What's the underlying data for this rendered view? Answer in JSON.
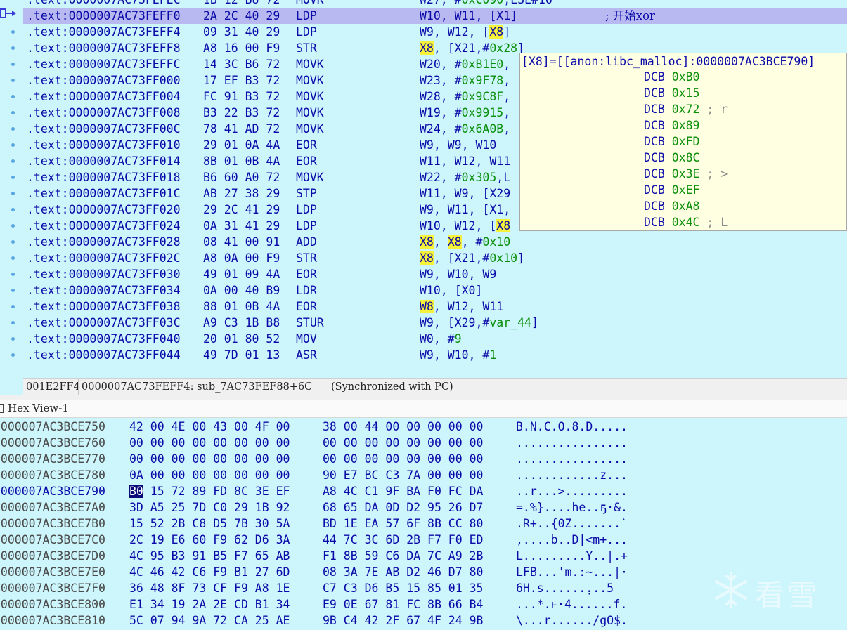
{
  "disassembly": {
    "rows": [
      {
        "addr": ".text:0000007AC73FEFEC",
        "bytes": "1B 12 B8 72",
        "mnem": "MOVK",
        "ops": [
          {
            "t": "W27, #"
          },
          {
            "t": "0xC090",
            "c": "num"
          },
          {
            "t": ",LSL#16"
          }
        ]
      },
      {
        "addr": ".text:0000007AC73FEFF0",
        "bytes": "2A 2C 40 29",
        "mnem": "LDP",
        "ops": [
          {
            "t": "W10, W11, [X1]"
          }
        ],
        "comment": "; 开始xor",
        "selected": true
      },
      {
        "addr": ".text:0000007AC73FEFF4",
        "bytes": "09 31 40 29",
        "mnem": "LDP",
        "ops": [
          {
            "t": "W9, W12, ["
          },
          {
            "t": "X8",
            "c": "hl"
          },
          {
            "t": "]"
          }
        ]
      },
      {
        "addr": ".text:0000007AC73FEFF8",
        "bytes": "A8 16 00 F9",
        "mnem": "STR",
        "ops": [
          {
            "t": "X8",
            "c": "hl"
          },
          {
            "t": ", [X21,#"
          },
          {
            "t": "0x28",
            "c": "num"
          },
          {
            "t": "]"
          }
        ]
      },
      {
        "addr": ".text:0000007AC73FEFFC",
        "bytes": "14 3C B6 72",
        "mnem": "MOVK",
        "ops": [
          {
            "t": "W20, #"
          },
          {
            "t": "0xB1E0",
            "c": "num"
          },
          {
            "t": ","
          }
        ]
      },
      {
        "addr": ".text:0000007AC73FF000",
        "bytes": "17 EF B3 72",
        "mnem": "MOVK",
        "ops": [
          {
            "t": "W23, #"
          },
          {
            "t": "0x9F78",
            "c": "num"
          },
          {
            "t": ","
          }
        ]
      },
      {
        "addr": ".text:0000007AC73FF004",
        "bytes": "FC 91 B3 72",
        "mnem": "MOVK",
        "ops": [
          {
            "t": "W28, #"
          },
          {
            "t": "0x9C8F",
            "c": "num"
          },
          {
            "t": ","
          }
        ]
      },
      {
        "addr": ".text:0000007AC73FF008",
        "bytes": "B3 22 B3 72",
        "mnem": "MOVK",
        "ops": [
          {
            "t": "W19, #"
          },
          {
            "t": "0x9915",
            "c": "num"
          },
          {
            "t": ","
          }
        ]
      },
      {
        "addr": ".text:0000007AC73FF00C",
        "bytes": "78 41 AD 72",
        "mnem": "MOVK",
        "ops": [
          {
            "t": "W24, #"
          },
          {
            "t": "0x6A0B",
            "c": "num"
          },
          {
            "t": ","
          }
        ]
      },
      {
        "addr": ".text:0000007AC73FF010",
        "bytes": "29 01 0A 4A",
        "mnem": "EOR",
        "ops": [
          {
            "t": "W9, W9, W10"
          }
        ]
      },
      {
        "addr": ".text:0000007AC73FF014",
        "bytes": "8B 01 0B 4A",
        "mnem": "EOR",
        "ops": [
          {
            "t": "W11, W12, W11"
          }
        ]
      },
      {
        "addr": ".text:0000007AC73FF018",
        "bytes": "B6 60 A0 72",
        "mnem": "MOVK",
        "ops": [
          {
            "t": "W22, #"
          },
          {
            "t": "0x305",
            "c": "num"
          },
          {
            "t": ",L"
          }
        ]
      },
      {
        "addr": ".text:0000007AC73FF01C",
        "bytes": "AB 27 38 29",
        "mnem": "STP",
        "ops": [
          {
            "t": "W11, W9, [X29"
          }
        ]
      },
      {
        "addr": ".text:0000007AC73FF020",
        "bytes": "29 2C 41 29",
        "mnem": "LDP",
        "ops": [
          {
            "t": "W9, W11, [X1,"
          }
        ]
      },
      {
        "addr": ".text:0000007AC73FF024",
        "bytes": "0A 31 41 29",
        "mnem": "LDP",
        "ops": [
          {
            "t": "W10, W12, ["
          },
          {
            "t": "X8",
            "c": "hl"
          }
        ]
      },
      {
        "addr": ".text:0000007AC73FF028",
        "bytes": "08 41 00 91",
        "mnem": "ADD",
        "ops": [
          {
            "t": "X8",
            "c": "hl"
          },
          {
            "t": ", "
          },
          {
            "t": "X8",
            "c": "hl"
          },
          {
            "t": ", #"
          },
          {
            "t": "0x10",
            "c": "num"
          }
        ]
      },
      {
        "addr": ".text:0000007AC73FF02C",
        "bytes": "A8 0A 00 F9",
        "mnem": "STR",
        "ops": [
          {
            "t": "X8",
            "c": "hl"
          },
          {
            "t": ", [X21,#"
          },
          {
            "t": "0x10",
            "c": "num"
          },
          {
            "t": "]"
          }
        ]
      },
      {
        "addr": ".text:0000007AC73FF030",
        "bytes": "49 01 09 4A",
        "mnem": "EOR",
        "ops": [
          {
            "t": "W9, W10, W9"
          }
        ]
      },
      {
        "addr": ".text:0000007AC73FF034",
        "bytes": "0A 00 40 B9",
        "mnem": "LDR",
        "ops": [
          {
            "t": "W10, [X0]"
          }
        ]
      },
      {
        "addr": ".text:0000007AC73FF038",
        "bytes": "88 01 0B 4A",
        "mnem": "EOR",
        "ops": [
          {
            "t": "W8",
            "c": "hl"
          },
          {
            "t": ", W12, W11"
          }
        ]
      },
      {
        "addr": ".text:0000007AC73FF03C",
        "bytes": "A9 C3 1B B8",
        "mnem": "STUR",
        "ops": [
          {
            "t": "W9, [X29,#"
          },
          {
            "t": "var_44",
            "c": "num"
          },
          {
            "t": "]"
          }
        ]
      },
      {
        "addr": ".text:0000007AC73FF040",
        "bytes": "20 01 80 52",
        "mnem": "MOV",
        "ops": [
          {
            "t": "W0, #"
          },
          {
            "t": "9",
            "c": "num"
          }
        ]
      },
      {
        "addr": ".text:0000007AC73FF044",
        "bytes": "49 7D 01 13",
        "mnem": "ASR",
        "ops": [
          {
            "t": "W9, W10, #"
          },
          {
            "t": "1",
            "c": "num"
          }
        ]
      }
    ]
  },
  "popup": {
    "title": "[X8]=[[anon:libc_malloc]:0000007AC3BCE790]",
    "items": [
      {
        "dir": "DCB",
        "val": "0xB0",
        "cmt": ""
      },
      {
        "dir": "DCB",
        "val": "0x15",
        "cmt": ""
      },
      {
        "dir": "DCB",
        "val": "0x72",
        "cmt": " ; r"
      },
      {
        "dir": "DCB",
        "val": "0x89",
        "cmt": ""
      },
      {
        "dir": "DCB",
        "val": "0xFD",
        "cmt": ""
      },
      {
        "dir": "DCB",
        "val": "0x8C",
        "cmt": ""
      },
      {
        "dir": "DCB",
        "val": "0x3E",
        "cmt": " ; >"
      },
      {
        "dir": "DCB",
        "val": "0xEF",
        "cmt": ""
      },
      {
        "dir": "DCB",
        "val": "0xA8",
        "cmt": ""
      },
      {
        "dir": "DCB",
        "val": "0x4C",
        "cmt": " ; L"
      }
    ]
  },
  "statusbar": {
    "offset": "001E2FF4",
    "location": "0000007AC73FEFF4: sub_7AC73FEF88+6C",
    "sync": "(Synchronized with PC)"
  },
  "hexview": {
    "tab_label": "Hex View-1",
    "rows": [
      {
        "addr": "0000007AC3BCE750",
        "b1": "42 00 4E 00 43 00 4F 00",
        "b2": "38 00 44 00 00 00 00 00",
        "ascii": "B.N.C.O.8.D....."
      },
      {
        "addr": "0000007AC3BCE760",
        "b1": "00 00 00 00 00 00 00 00",
        "b2": "00 00 00 00 00 00 00 00",
        "ascii": "................"
      },
      {
        "addr": "0000007AC3BCE770",
        "b1": "00 00 00 00 00 00 00 00",
        "b2": "00 00 00 00 00 00 00 00",
        "ascii": "................"
      },
      {
        "addr": "0000007AC3BCE780",
        "b1": "0A 00 00 00 00 00 00 00",
        "b2": "90 E7 BC C3 7A 00 00 00",
        "ascii": "............z..."
      },
      {
        "addr": "0000007AC3BCE790",
        "b1_first": "B0",
        "b1_rest": " 15 72 89 FD 8C 3E EF",
        "b2": "A8 4C C1 9F BA F0 FC DA",
        "ascii": "..r...>.........",
        "current": true
      },
      {
        "addr": "0000007AC3BCE7A0",
        "b1": "3D A5 25 7D C0 29 1B 92",
        "b2": "68 65 DA 0D D2 95 26 D7",
        "ascii": "=.%}....he..ҕ·&."
      },
      {
        "addr": "0000007AC3BCE7B0",
        "b1": "15 52 2B C8 D5 7B 30 5A",
        "b2": "BD 1E EA 57 6F 8B CC 80",
        "ascii": ".R+..{0Z.......̀"
      },
      {
        "addr": "0000007AC3BCE7C0",
        "b1": "2C 19 E6 60 F9 62 D6 3A",
        "b2": "44 7C 3C 6D 2B F7 F0 ED",
        "ascii": ",....b..D|<m+..."
      },
      {
        "addr": "0000007AC3BCE7D0",
        "b1": "4C 95 B3 91 B5 F7 65 AB",
        "b2": "F1 8B 59 C6 DA 7C A9 2B",
        "ascii": "L.........Y..|.+"
      },
      {
        "addr": "0000007AC3BCE7E0",
        "b1": "4C 46 42 C6 F9 B1 27 6D",
        "b2": "08 3A 7E AB D2 46 D7 80",
        "ascii": "LFB...'m.:~...|·"
      },
      {
        "addr": "0000007AC3BCE7F0",
        "b1": "36 48 8F 73 CF F9 A8 1E",
        "b2": "C7 C3 D6 B5 15 85 01 35",
        "ascii": "6H.s......̣...5"
      },
      {
        "addr": "0000007AC3BCE800",
        "b1": "E1 34 19 2A 2E CD B1 34",
        "b2": "E9 0E 67 81 FC 8B 66 B4",
        "ascii": "...*.ͱ·4......f."
      },
      {
        "addr": "0000007AC3BCE810",
        "b1": "5C 07 94 9A 72 CA 25 AE",
        "b2": "9B C4 42 2F 67 4F 24 9B",
        "ascii": "\\...r....../gO$."
      }
    ]
  },
  "watermark": {
    "text": "看雪"
  },
  "colors": {
    "background": "#cdf6fc",
    "code": "#0a0aa8",
    "number": "#0b8f0b",
    "highlight": "#f6f23a",
    "selection": "#b9b9f2",
    "popup": "#ffffe1"
  }
}
